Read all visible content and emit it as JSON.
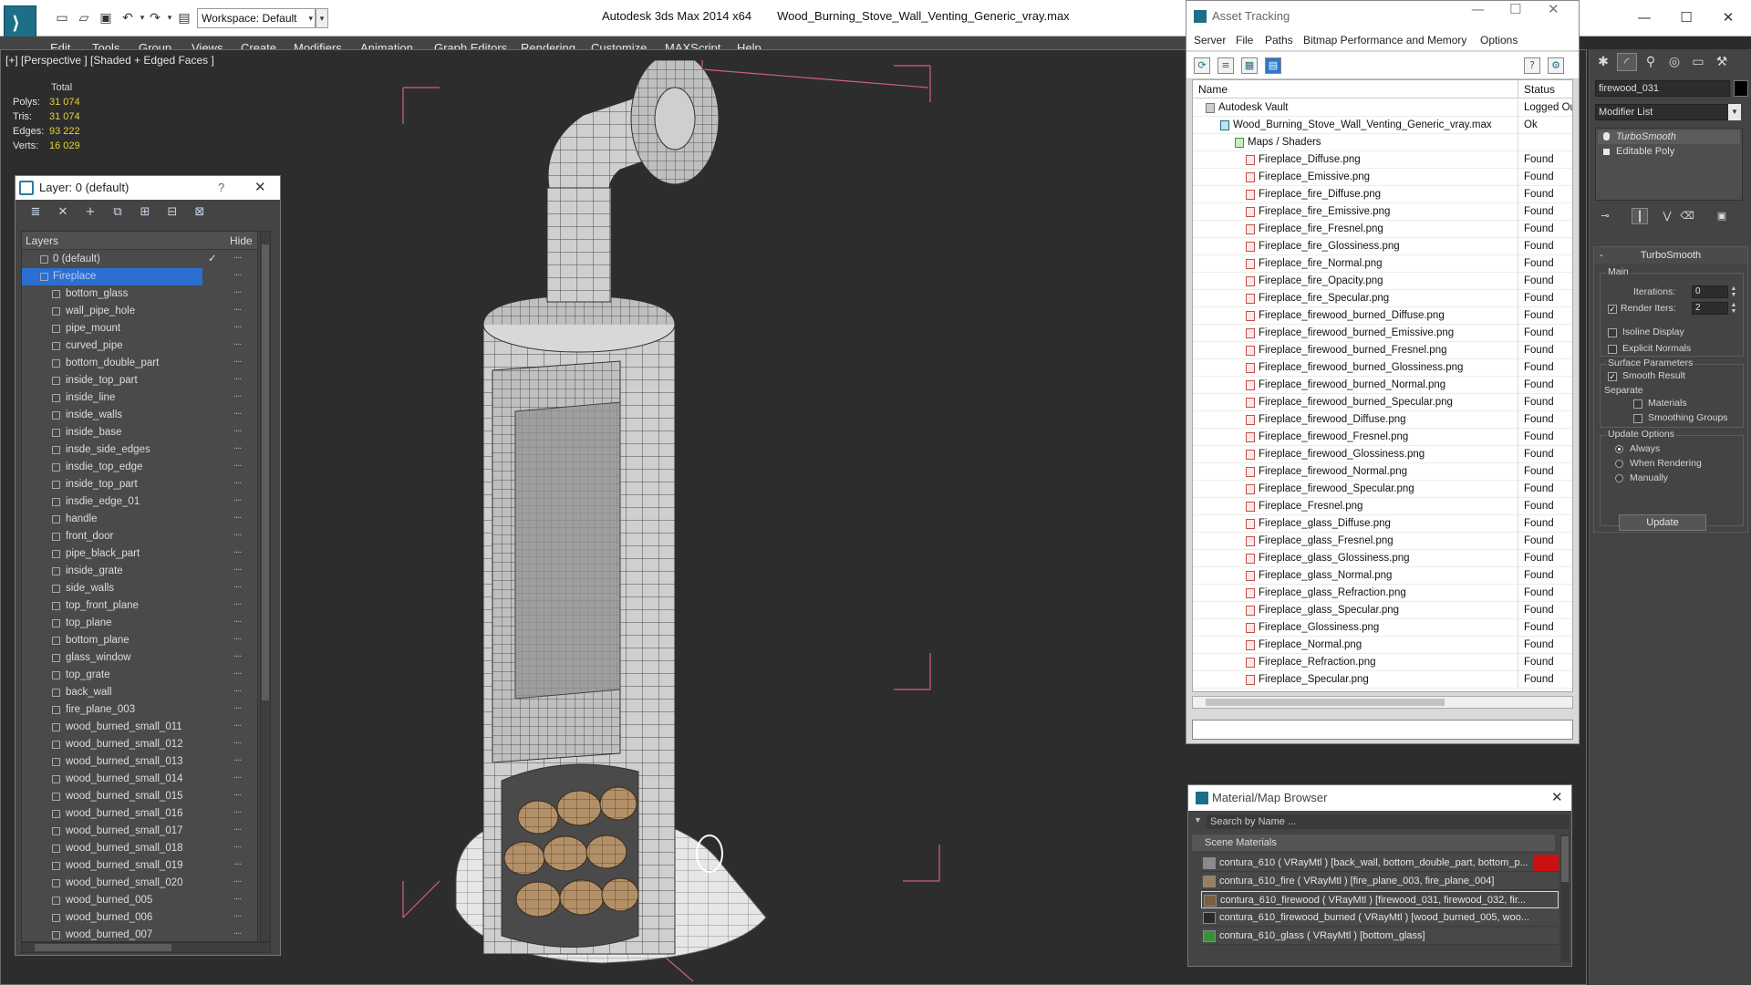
{
  "app": {
    "name": "Autodesk 3ds Max  2014 x64",
    "file": "Wood_Burning_Stove_Wall_Venting_Generic_vray.max",
    "workspace": "Workspace: Default"
  },
  "menu": [
    "Edit",
    "Tools",
    "Group",
    "Views",
    "Create",
    "Modifiers",
    "Animation",
    "Graph Editors",
    "Rendering",
    "Customize",
    "MAXScript",
    "Help"
  ],
  "viewport": {
    "label": "[+] [Perspective ] [Shaded + Edged Faces ]",
    "stats": {
      "header": "Total",
      "rows": [
        {
          "label": "Polys:",
          "value": "31 074"
        },
        {
          "label": "Tris:",
          "value": "31 074"
        },
        {
          "label": "Edges:",
          "value": "93 222"
        },
        {
          "label": "Verts:",
          "value": "16 029"
        }
      ]
    }
  },
  "layer_panel": {
    "title": "Layer: 0 (default)",
    "help": "?",
    "col_layers": "Layers",
    "col_hide": "Hide",
    "rows": [
      {
        "label": "0 (default)",
        "top": true,
        "check": "✓"
      },
      {
        "label": "Fireplace",
        "top": true,
        "selected": true
      },
      {
        "label": "bottom_glass"
      },
      {
        "label": "wall_pipe_hole"
      },
      {
        "label": "pipe_mount"
      },
      {
        "label": "curved_pipe"
      },
      {
        "label": "bottom_double_part"
      },
      {
        "label": "inside_top_part"
      },
      {
        "label": "inside_line"
      },
      {
        "label": "inside_walls"
      },
      {
        "label": "inside_base"
      },
      {
        "label": "insde_side_edges"
      },
      {
        "label": "insdie_top_edge"
      },
      {
        "label": "inside_top_part"
      },
      {
        "label": "insdie_edge_01"
      },
      {
        "label": "handle"
      },
      {
        "label": "front_door"
      },
      {
        "label": "pipe_black_part"
      },
      {
        "label": "inside_grate"
      },
      {
        "label": "side_walls"
      },
      {
        "label": "top_front_plane"
      },
      {
        "label": "top_plane"
      },
      {
        "label": "bottom_plane"
      },
      {
        "label": "glass_window"
      },
      {
        "label": "top_grate"
      },
      {
        "label": "back_wall"
      },
      {
        "label": "fire_plane_003"
      },
      {
        "label": "wood_burned_small_011"
      },
      {
        "label": "wood_burned_small_012"
      },
      {
        "label": "wood_burned_small_013"
      },
      {
        "label": "wood_burned_small_014"
      },
      {
        "label": "wood_burned_small_015"
      },
      {
        "label": "wood_burned_small_016"
      },
      {
        "label": "wood_burned_small_017"
      },
      {
        "label": "wood_burned_small_018"
      },
      {
        "label": "wood_burned_small_019"
      },
      {
        "label": "wood_burned_small_020"
      },
      {
        "label": "wood_burned_005"
      },
      {
        "label": "wood_burned_006"
      },
      {
        "label": "wood_burned_007"
      }
    ]
  },
  "asset_tracking": {
    "title": "Asset Tracking",
    "menu": [
      "Server",
      "File",
      "Paths",
      "Bitmap Performance and Memory",
      "Options"
    ],
    "col_name": "Name",
    "col_status": "Status",
    "rows": [
      {
        "name": "Autodesk Vault",
        "status": "Logged Out",
        "level": 0,
        "kind": "vault"
      },
      {
        "name": "Wood_Burning_Stove_Wall_Venting_Generic_vray.max",
        "status": "Ok",
        "level": 1,
        "kind": "max"
      },
      {
        "name": "Maps / Shaders",
        "status": "",
        "level": 2,
        "kind": "map"
      },
      {
        "name": "Fireplace_Diffuse.png",
        "status": "Found",
        "level": 3,
        "kind": "png"
      },
      {
        "name": "Fireplace_Emissive.png",
        "status": "Found",
        "level": 3,
        "kind": "png"
      },
      {
        "name": "Fireplace_fire_Diffuse.png",
        "status": "Found",
        "level": 3,
        "kind": "png"
      },
      {
        "name": "Fireplace_fire_Emissive.png",
        "status": "Found",
        "level": 3,
        "kind": "png"
      },
      {
        "name": "Fireplace_fire_Fresnel.png",
        "status": "Found",
        "level": 3,
        "kind": "png"
      },
      {
        "name": "Fireplace_fire_Glossiness.png",
        "status": "Found",
        "level": 3,
        "kind": "png"
      },
      {
        "name": "Fireplace_fire_Normal.png",
        "status": "Found",
        "level": 3,
        "kind": "png"
      },
      {
        "name": "Fireplace_fire_Opacity.png",
        "status": "Found",
        "level": 3,
        "kind": "png"
      },
      {
        "name": "Fireplace_fire_Specular.png",
        "status": "Found",
        "level": 3,
        "kind": "png"
      },
      {
        "name": "Fireplace_firewood_burned_Diffuse.png",
        "status": "Found",
        "level": 3,
        "kind": "png"
      },
      {
        "name": "Fireplace_firewood_burned_Emissive.png",
        "status": "Found",
        "level": 3,
        "kind": "png"
      },
      {
        "name": "Fireplace_firewood_burned_Fresnel.png",
        "status": "Found",
        "level": 3,
        "kind": "png"
      },
      {
        "name": "Fireplace_firewood_burned_Glossiness.png",
        "status": "Found",
        "level": 3,
        "kind": "png"
      },
      {
        "name": "Fireplace_firewood_burned_Normal.png",
        "status": "Found",
        "level": 3,
        "kind": "png"
      },
      {
        "name": "Fireplace_firewood_burned_Specular.png",
        "status": "Found",
        "level": 3,
        "kind": "png"
      },
      {
        "name": "Fireplace_firewood_Diffuse.png",
        "status": "Found",
        "level": 3,
        "kind": "png"
      },
      {
        "name": "Fireplace_firewood_Fresnel.png",
        "status": "Found",
        "level": 3,
        "kind": "png"
      },
      {
        "name": "Fireplace_firewood_Glossiness.png",
        "status": "Found",
        "level": 3,
        "kind": "png"
      },
      {
        "name": "Fireplace_firewood_Normal.png",
        "status": "Found",
        "level": 3,
        "kind": "png"
      },
      {
        "name": "Fireplace_firewood_Specular.png",
        "status": "Found",
        "level": 3,
        "kind": "png"
      },
      {
        "name": "Fireplace_Fresnel.png",
        "status": "Found",
        "level": 3,
        "kind": "png"
      },
      {
        "name": "Fireplace_glass_Diffuse.png",
        "status": "Found",
        "level": 3,
        "kind": "png"
      },
      {
        "name": "Fireplace_glass_Fresnel.png",
        "status": "Found",
        "level": 3,
        "kind": "png"
      },
      {
        "name": "Fireplace_glass_Glossiness.png",
        "status": "Found",
        "level": 3,
        "kind": "png"
      },
      {
        "name": "Fireplace_glass_Normal.png",
        "status": "Found",
        "level": 3,
        "kind": "png"
      },
      {
        "name": "Fireplace_glass_Refraction.png",
        "status": "Found",
        "level": 3,
        "kind": "png"
      },
      {
        "name": "Fireplace_glass_Specular.png",
        "status": "Found",
        "level": 3,
        "kind": "png"
      },
      {
        "name": "Fireplace_Glossiness.png",
        "status": "Found",
        "level": 3,
        "kind": "png"
      },
      {
        "name": "Fireplace_Normal.png",
        "status": "Found",
        "level": 3,
        "kind": "png"
      },
      {
        "name": "Fireplace_Refraction.png",
        "status": "Found",
        "level": 3,
        "kind": "png"
      },
      {
        "name": "Fireplace_Specular.png",
        "status": "Found",
        "level": 3,
        "kind": "png"
      }
    ]
  },
  "material_browser": {
    "title": "Material/Map Browser",
    "search_placeholder": "Search by Name ...",
    "section": "Scene Materials",
    "rows": [
      {
        "text": "contura_610  ( VRayMtl ) [back_wall, bottom_double_part, bottom_p...",
        "swatch": "#8a8a8a",
        "redtag": true
      },
      {
        "text": "contura_610_fire  ( VRayMtl ) [fire_plane_003, fire_plane_004]",
        "swatch": "#9a8060"
      },
      {
        "text": "contura_610_firewood  ( VRayMtl ) [firewood_031, firewood_032, fir...",
        "swatch": "#7a6040",
        "highlight": true
      },
      {
        "text": "contura_610_firewood_burned  ( VRayMtl ) [wood_burned_005, woo...",
        "swatch": "#2a2a2a"
      },
      {
        "text": "contura_610_glass  ( VRayMtl ) [bottom_glass]",
        "swatch": "#3b8f3b"
      }
    ]
  },
  "command_panel": {
    "object_name": "firewood_031",
    "modifier_list": "Modifier List",
    "stack": [
      "TurboSmooth",
      "Editable Poly"
    ],
    "rollout_title": "TurboSmooth",
    "main_label": "Main",
    "iterations_label": "Iterations:",
    "iterations_value": "0",
    "render_iters_label": "Render Iters:",
    "render_iters_value": "2",
    "isoline_label": "Isoline Display",
    "explicit_label": "Explicit Normals",
    "surface_label": "Surface Parameters",
    "smooth_label": "Smooth Result",
    "separate_label": "Separate",
    "materials_label": "Materials",
    "smoothing_label": "Smoothing Groups",
    "update_options_label": "Update Options",
    "always_label": "Always",
    "when_rendering_label": "When Rendering",
    "manually_label": "Manually",
    "update_button": "Update"
  }
}
